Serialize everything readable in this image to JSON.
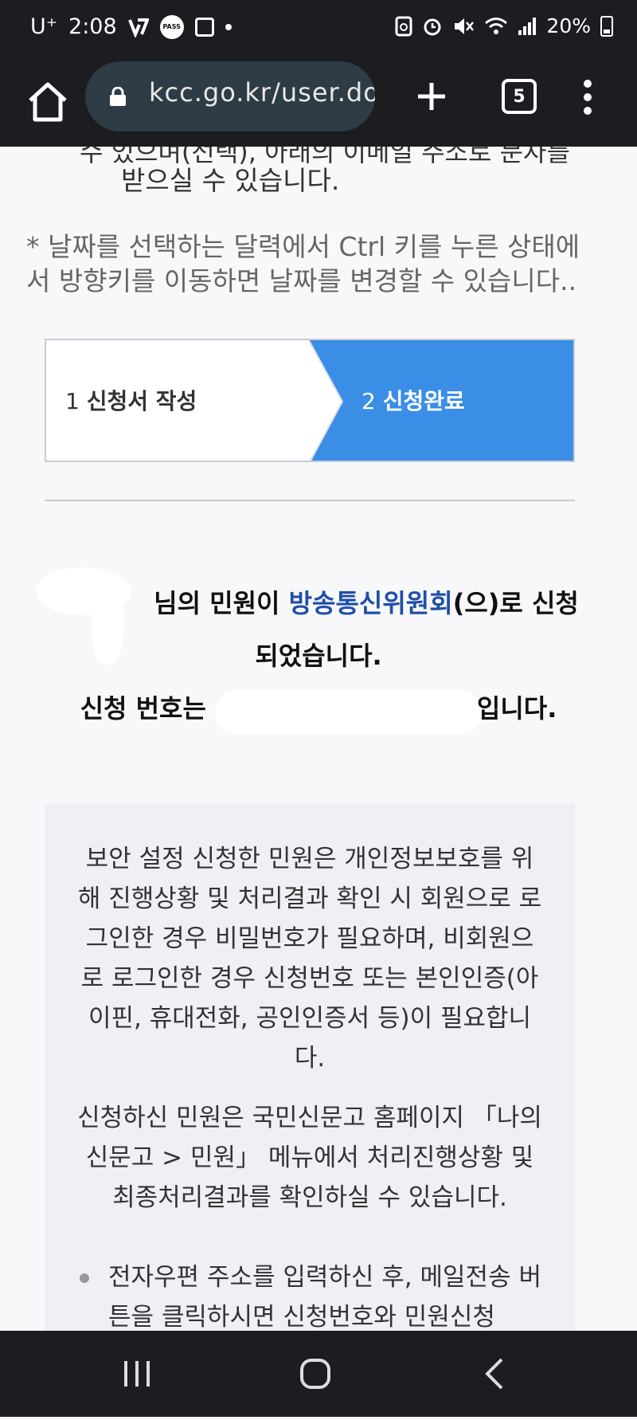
{
  "status_bar": {
    "carrier": "U⁺",
    "time": "2:08",
    "app_icon_pass": "PASS",
    "battery": "20%"
  },
  "browser": {
    "url": "kcc.go.kr/user.do",
    "tab_count": "5"
  },
  "content": {
    "cut_line": "수 있으며(선택), 아래의 이메일 주소로 문자를",
    "top_line": "받으실 수 있습니다.",
    "calendar_note": "* 날짜를 선택하는 달력에서 Ctrl 키를 누른 상태에서 방향키를 이동하면 날짜를 변경할 수 있습니다..",
    "steps": [
      {
        "number": "1",
        "label": "신청서 작성"
      },
      {
        "number": "2",
        "label": "신청완료"
      }
    ],
    "message": {
      "line1_prefix": "님의 민원이 ",
      "organization": "방송통신위원회",
      "line1_suffix": "(으)로 신청",
      "line2": "되었습니다.",
      "line3_prefix": "신청 번호는",
      "line3_suffix": "입니다."
    },
    "info": {
      "paragraph1": "보안 설정 신청한 민원은 개인정보보호를 위해 진행상황 및 처리결과 확인 시 회원으로 로그인한 경우 비밀번호가 필요하며, 비회원으로 로그인한 경우 신청번호 또는 본인인증(아이핀, 휴대전화, 공인인증서 등)이 필요합니다.",
      "paragraph2": "신청하신 민원은 국민신문고 홈페이지 「나의 신문고 > 민원」 메뉴에서 처리진행상황 및 최종처리결과를 확인하실 수 있습니다.",
      "bullet1": "전자우편 주소를 입력하신 후, 메일전송 버튼을 클릭하시면 신청번호와 민원신청"
    }
  },
  "colors": {
    "active_step": "#3a8ee6",
    "organization_link": "#1f4fa8",
    "chrome_dark": "#1b1d21"
  }
}
